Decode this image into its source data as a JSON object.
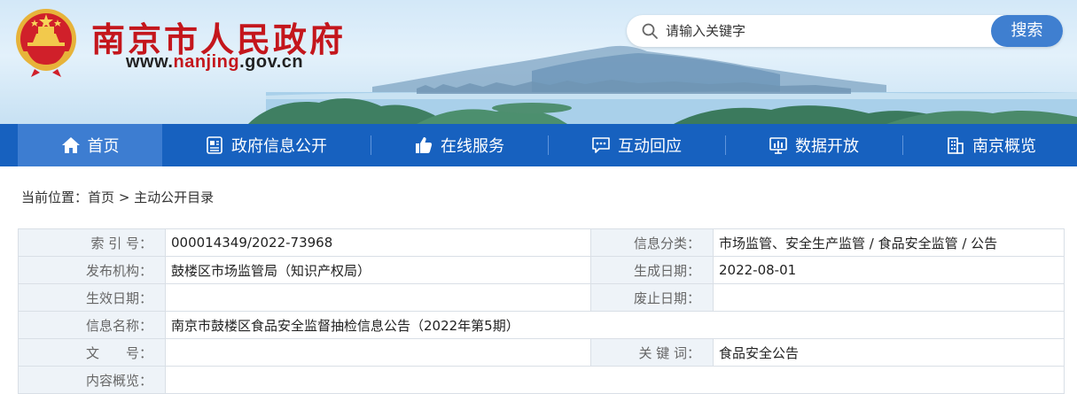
{
  "header": {
    "title": "南京市人民政府",
    "url_prefix": "www.",
    "url_brand": "nanjing",
    "url_suffix": ".gov.cn",
    "emblem_icon": "national-emblem-icon",
    "colors": {
      "title": "#c4161c",
      "search_button": "#3f7fd0"
    }
  },
  "search": {
    "placeholder": "请输入关键字",
    "button_label": "搜索"
  },
  "nav": {
    "background": "#1761bf",
    "active_background": "#3d7dd1",
    "items": [
      {
        "label": "首页",
        "icon": "home-icon",
        "active": true
      },
      {
        "label": "政府信息公开",
        "icon": "document-icon",
        "active": false
      },
      {
        "label": "在线服务",
        "icon": "thumbs-up-icon",
        "active": false
      },
      {
        "label": "互动回应",
        "icon": "chat-icon",
        "active": false
      },
      {
        "label": "数据开放",
        "icon": "chart-icon",
        "active": false
      },
      {
        "label": "南京概览",
        "icon": "building-icon",
        "active": false
      }
    ]
  },
  "breadcrumb": {
    "prefix": "当前位置：",
    "items": [
      "首页",
      "主动公开目录"
    ],
    "separator": ">"
  },
  "info": {
    "rows": [
      {
        "l1": "索 引 号：",
        "v1": "000014349/2022-73968",
        "l2": "信息分类：",
        "v2": "市场监管、安全生产监管 / 食品安全监管 / 公告"
      },
      {
        "l1": "发布机构：",
        "v1": "鼓楼区市场监管局（知识产权局）",
        "l2": "生成日期：",
        "v2": "2022-08-01"
      },
      {
        "l1": "生效日期：",
        "v1": "",
        "l2": "废止日期：",
        "v2": ""
      },
      {
        "l1": "信息名称：",
        "v1": "南京市鼓楼区食品安全监督抽检信息公告（2022年第5期）"
      },
      {
        "l1": "文　　号：",
        "v1": "",
        "l2": "关 键 词：",
        "v2": "食品安全公告"
      },
      {
        "l1": "内容概览：",
        "v1": ""
      }
    ]
  }
}
